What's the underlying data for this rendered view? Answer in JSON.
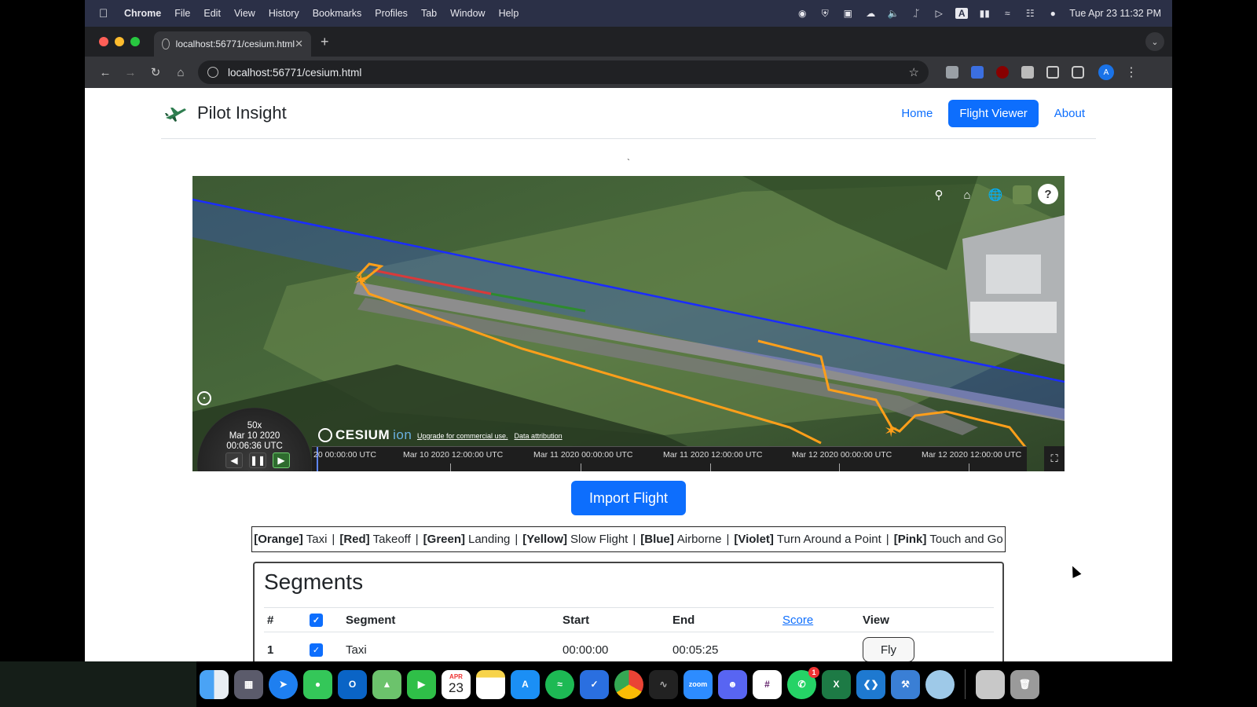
{
  "menubar": {
    "app": "Chrome",
    "items": [
      "File",
      "Edit",
      "View",
      "History",
      "Bookmarks",
      "Profiles",
      "Tab",
      "Window",
      "Help"
    ],
    "clock": "Tue Apr 23  11:32 PM",
    "input_source": "A"
  },
  "browser": {
    "tab_title": "localhost:56771/cesium.html",
    "url": "localhost:56771/cesium.html",
    "profile_initial": "A"
  },
  "site": {
    "brand": "Pilot Insight",
    "nav": [
      {
        "label": "Home",
        "active": false
      },
      {
        "label": "Flight Viewer",
        "active": true
      },
      {
        "label": "About",
        "active": false
      }
    ],
    "stray_mark": "`"
  },
  "viewer": {
    "animation": {
      "speed": "50x",
      "date": "Mar 10 2020",
      "time": "00:06:36 UTC"
    },
    "cesium_logo": "CESIUM",
    "cesium_logo_suffix": "ion",
    "credits": [
      "Upgrade for commercial use.",
      "Data attribution"
    ],
    "timeline_labels": [
      "20 00:00:00 UTC",
      "Mar 10 2020 12:00:00 UTC",
      "Mar 11 2020 00:00:00 UTC",
      "Mar 11 2020 12:00:00 UTC",
      "Mar 12 2020 00:00:00 UTC",
      "Mar 12 2020 12:00:00 UTC"
    ],
    "toolbar_icons": [
      "search-icon",
      "home-icon",
      "globe-icon",
      "imagery-icon",
      "help-icon"
    ],
    "help_glyph": "?"
  },
  "import_button": "Import Flight",
  "legend": [
    {
      "color": "[Orange]",
      "label": "Taxi"
    },
    {
      "color": "[Red]",
      "label": "Takeoff"
    },
    {
      "color": "[Green]",
      "label": "Landing"
    },
    {
      "color": "[Yellow]",
      "label": "Slow Flight"
    },
    {
      "color": "[Blue]",
      "label": "Airborne"
    },
    {
      "color": "[Violet]",
      "label": "Turn Around a Point"
    },
    {
      "color": "[Pink]",
      "label": "Touch and Go"
    }
  ],
  "segments": {
    "title": "Segments",
    "headers": {
      "num": "#",
      "segment": "Segment",
      "start": "Start",
      "end": "End",
      "score": "Score",
      "view": "View"
    },
    "rows": [
      {
        "num": "1",
        "checked": true,
        "segment": "Taxi",
        "start": "00:00:00",
        "end": "00:05:25",
        "score": "",
        "view": "Fly"
      }
    ]
  },
  "dock": {
    "calendar_month": "APR",
    "calendar_day": "23",
    "whatsapp_badge": "1",
    "zoom_label": "zoom"
  },
  "colors": {
    "accent": "#0d6efd",
    "track_taxi": "#ff9f1a",
    "track_blue": "#1a2cff",
    "track_red": "#d83a3a",
    "track_green": "#2e8b2e"
  }
}
